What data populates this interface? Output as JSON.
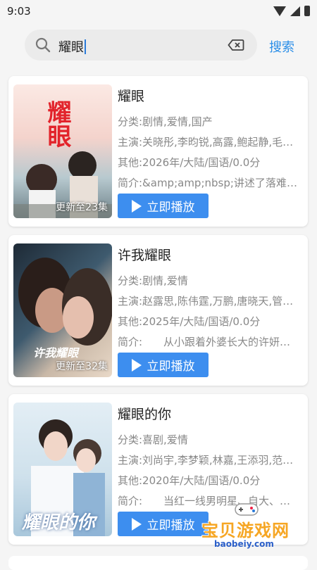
{
  "status": {
    "time": "9:03"
  },
  "search": {
    "query": "耀眼",
    "button_label": "搜索"
  },
  "results": [
    {
      "title": "耀眼",
      "genre": "分类:剧情,爱情,国产",
      "cast": "主演:关晓彤,李昀锐,高露,鲍起静,毛…",
      "other": "其他:2026年/大陆/国语/0.0分",
      "intro": "简介:&amp;amp;nbsp;讲述了落难千…",
      "badge": "更新至23集",
      "poster_title": "耀眼",
      "play_label": "立即播放"
    },
    {
      "title": "许我耀眼",
      "genre": "分类:剧情,爱情",
      "cast": "主演:赵露思,陈伟霆,万鹏,唐晓天,管…",
      "other": "其他:2025年/大陆/国语/0.0分",
      "intro": "简介:　　从小跟着外婆长大的许妍…",
      "badge": "更新至32集",
      "poster_title": "许我耀眼",
      "play_label": "立即播放"
    },
    {
      "title": "耀眼的你",
      "genre": "分类:喜剧,爱情",
      "cast": "主演:刘尚宇,李梦颖,林嘉,王添羽,范…",
      "other": "其他:2020年/大陆/国语/0.0分",
      "intro": "简介:　　当红一线男明星、自大、…",
      "badge": "",
      "poster_title": "耀眼的你",
      "play_label": "立即播放"
    }
  ],
  "watermark": {
    "name": "宝贝游戏网",
    "url": "baobeiy.com"
  },
  "colors": {
    "accent": "#3d8eef",
    "link": "#2a8ee8",
    "watermark": "#f6a623"
  }
}
